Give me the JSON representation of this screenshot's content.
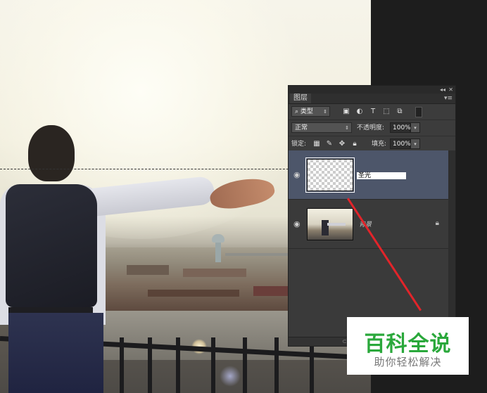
{
  "layers_panel": {
    "tab_label": "图层",
    "collapse_icon": "double-arrow-icon",
    "close_icon": "close-icon",
    "filter": {
      "search_icon_char": "⌕",
      "kind_value": "类型"
    },
    "filter_icons": [
      "image-filter-icon",
      "adjustment-filter-icon",
      "text-filter-icon",
      "shape-filter-icon",
      "smartobject-filter-icon"
    ],
    "blend_mode": "正常",
    "opacity_label": "不透明度:",
    "opacity_value": "100%",
    "lock_label": "锁定:",
    "fill_label": "填充:",
    "fill_value": "100%",
    "layers": [
      {
        "name": "圣光",
        "editing": true,
        "selected": true,
        "thumbnail": "transparent"
      },
      {
        "name": "背景",
        "editing": false,
        "selected": false,
        "thumbnail": "photo",
        "locked": true
      }
    ]
  },
  "watermark": {
    "title": "百科全说",
    "subtitle": "助你轻松解决"
  },
  "colors": {
    "panel_bg": "#3c3c3c",
    "selected_layer": "#4d566a",
    "annotation_line": "#e2242a",
    "watermark_green": "#2aa83b"
  }
}
